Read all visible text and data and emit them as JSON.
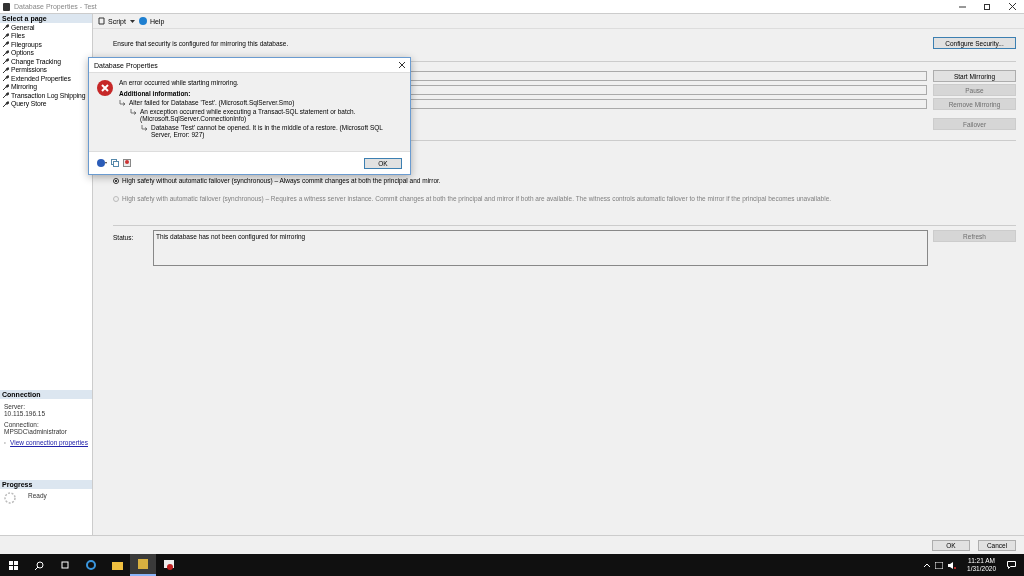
{
  "window": {
    "title": "Database Properties - Test"
  },
  "sidebar": {
    "heading": "Select a page",
    "items": [
      {
        "label": "General"
      },
      {
        "label": "Files"
      },
      {
        "label": "Filegroups"
      },
      {
        "label": "Options"
      },
      {
        "label": "Change Tracking"
      },
      {
        "label": "Permissions"
      },
      {
        "label": "Extended Properties"
      },
      {
        "label": "Mirroring"
      },
      {
        "label": "Transaction Log Shipping"
      },
      {
        "label": "Query Store"
      }
    ]
  },
  "connection": {
    "heading": "Connection",
    "server_label": "Server:",
    "server": "10.115.196.15",
    "connection_label": "Connection:",
    "connection": "MPSDC\\administrator",
    "link": "View connection properties"
  },
  "progress": {
    "heading": "Progress",
    "status": "Ready"
  },
  "toolbar": {
    "script": "Script",
    "help": "Help"
  },
  "mirroring": {
    "note": "Ensure that security is configured for mirroring this database.",
    "configure_button": {
      "label": "Configure Security...",
      "disabled": false
    },
    "action_buttons": [
      {
        "label": "Start Mirroring",
        "disabled": false
      },
      {
        "label": "Pause",
        "disabled": true
      },
      {
        "label": "Remove Mirroring",
        "disabled": true
      }
    ],
    "failover_button": {
      "label": "Failover",
      "disabled": true
    },
    "operating_modes": [
      {
        "label": "High safety without automatic failover (synchronous) – Always commit changes at both the principal and mirror.",
        "selected": true,
        "disabled": false
      },
      {
        "label": "High safety with automatic failover (synchronous) – Requires a witness server instance. Commit changes at both the principal and mirror if both are available. The witness controls automatic failover to the mirror if the principal becomes unavailable.",
        "selected": false,
        "disabled": true
      }
    ],
    "status_label": "Status:",
    "status": "This database has not been configured for mirroring",
    "refresh_button": {
      "label": "Refresh",
      "disabled": true
    }
  },
  "dialog": {
    "title": "Database Properties",
    "message": "An error occurred while starting mirroring.",
    "details_heading": "Additional information:",
    "details": [
      {
        "text": "Alter failed for Database 'Test'.  (Microsoft.SqlServer.Smo)",
        "children": [
          {
            "text": "An exception occurred while executing a Transact-SQL statement or batch. (Microsoft.SqlServer.ConnectionInfo)",
            "children": [
              {
                "text": "Database 'Test' cannot be opened. It is in the middle of a restore. (Microsoft SQL Server, Error: 927)"
              }
            ]
          }
        ]
      }
    ],
    "ok": "OK"
  },
  "footer": {
    "buttons": [
      "OK",
      "Cancel"
    ]
  },
  "taskbar": {
    "time": "11:21 AM",
    "date": "1/31/2020"
  }
}
